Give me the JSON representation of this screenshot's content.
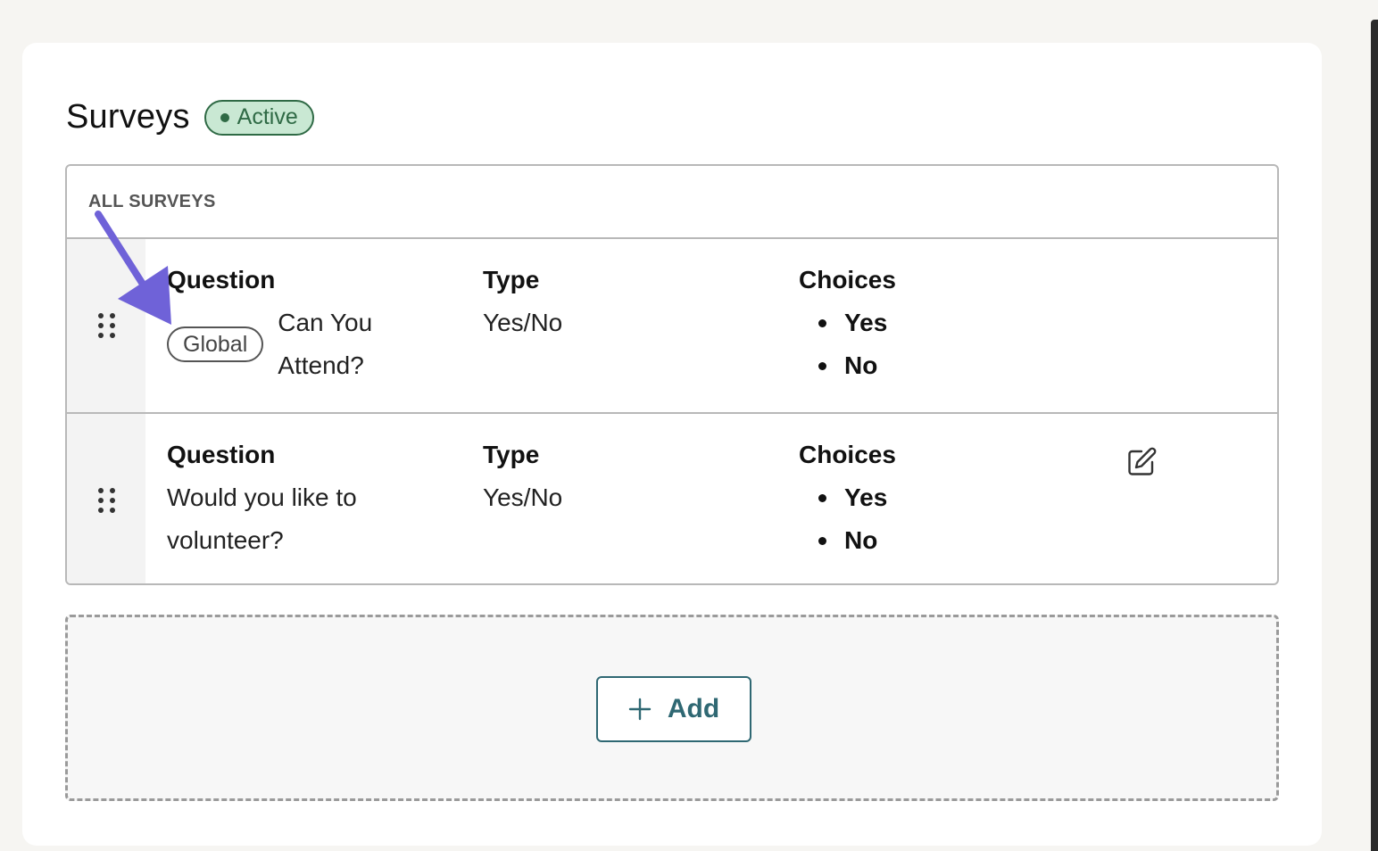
{
  "section": {
    "title": "Surveys",
    "status_badge": "Active"
  },
  "table": {
    "header": "ALL SURVEYS",
    "rows": [
      {
        "question_label": "Question",
        "question_tag": "Global",
        "question_text": "Can You Attend?",
        "type_label": "Type",
        "type_value": "Yes/No",
        "choices_label": "Choices",
        "choices": [
          "Yes",
          "No"
        ]
      },
      {
        "question_label": "Question",
        "question_text": "Would you like to volunteer?",
        "type_label": "Type",
        "type_value": "Yes/No",
        "choices_label": "Choices",
        "choices": [
          "Yes",
          "No"
        ]
      }
    ]
  },
  "add_button": {
    "label": "Add"
  },
  "colors": {
    "page_bg": "#f6f5f2",
    "badge_bg": "#c9e8d3",
    "badge_fg": "#2f6a45",
    "accent": "#2f6873",
    "annotation_arrow": "#6f62d8"
  },
  "icons": [
    "drag-handle-icon",
    "edit-pencil-icon",
    "plus-icon",
    "annotation-arrow"
  ]
}
